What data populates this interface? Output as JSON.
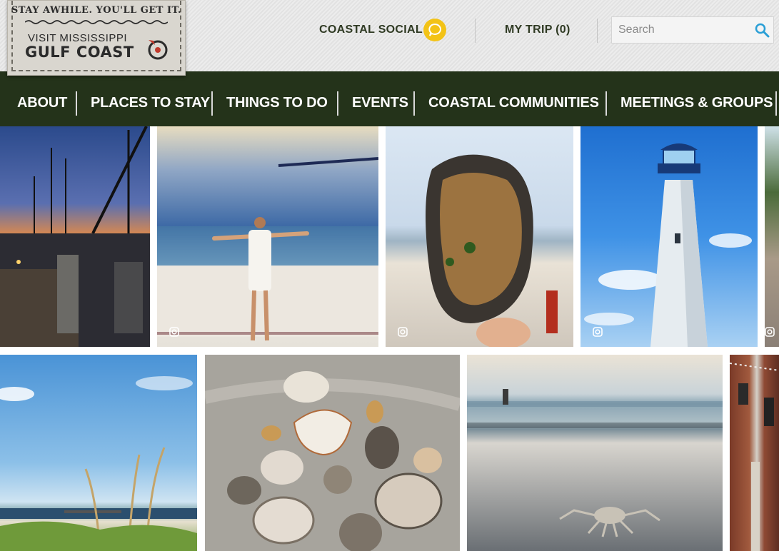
{
  "header": {
    "logo": {
      "tagline": "STAY AWHILE. YOU'LL GET IT.",
      "line1": "VISIT MISSISSIPPI",
      "line2": "GULF COAST"
    },
    "coastal_social_label": "COASTAL SOCIAL",
    "my_trip_label": "MY TRIP (0)",
    "search": {
      "placeholder": "Search",
      "value": ""
    }
  },
  "main_nav": {
    "items": [
      {
        "label": "ABOUT"
      },
      {
        "label": "PLACES TO STAY"
      },
      {
        "label": "THINGS TO DO"
      },
      {
        "label": "EVENTS"
      },
      {
        "label": "COASTAL COMMUNITIES"
      },
      {
        "label": "MEETINGS & GROUPS"
      }
    ]
  },
  "colors": {
    "nav_bg": "#24331a",
    "accent_yellow": "#f3c316",
    "search_icon": "#2a9fd6",
    "header_text": "#2f3a23"
  },
  "photo_grid": {
    "photos": [
      {
        "subject": "marina-sunset",
        "instagram_icon": false
      },
      {
        "subject": "mosaic-wall-woman",
        "instagram_icon": true
      },
      {
        "subject": "grilled-oyster",
        "instagram_icon": true
      },
      {
        "subject": "lighthouse",
        "instagram_icon": true
      },
      {
        "subject": "partial-edge-photo",
        "instagram_icon": true
      },
      {
        "subject": "sea-oats-beach",
        "instagram_icon": false
      },
      {
        "subject": "shells-on-sand",
        "instagram_icon": false
      },
      {
        "subject": "crab-on-beach",
        "instagram_icon": false
      },
      {
        "subject": "brick-building",
        "instagram_icon": false
      }
    ]
  }
}
